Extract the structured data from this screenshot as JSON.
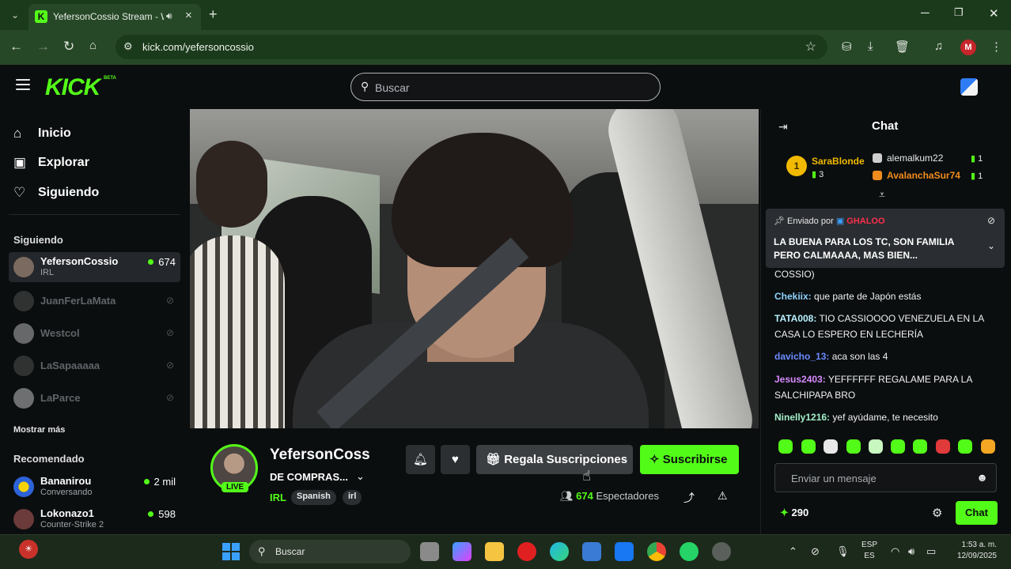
{
  "browser": {
    "tab_title": "YefersonCossio Stream - W",
    "new_tab": "+",
    "url": "kick.com/yefersoncossio",
    "profile_initial": "M",
    "win_minimize": "─",
    "win_maximize": "❐",
    "win_close": "✕"
  },
  "header": {
    "logo": "KICK",
    "logo_sup": "BETA",
    "search_placeholder": "Buscar"
  },
  "sidebar": {
    "nav": [
      {
        "label": "Inicio",
        "icon": "home-icon"
      },
      {
        "label": "Explorar",
        "icon": "compass-icon"
      },
      {
        "label": "Siguiendo",
        "icon": "heart-icon"
      }
    ],
    "following_heading": "Siguiendo",
    "following": [
      {
        "name": "YefersonCossio",
        "category": "IRL",
        "viewers": "674",
        "live": true
      },
      {
        "name": "JuanFerLaMata",
        "live": false
      },
      {
        "name": "Westcol",
        "live": false
      },
      {
        "name": "LaSapaaaaa",
        "live": false
      },
      {
        "name": "LaParce",
        "live": false
      }
    ],
    "show_more": "Mostrar más",
    "recommended_heading": "Recomendado",
    "recommended": [
      {
        "name": "Bananirou",
        "category": "Conversando",
        "viewers": "2 mil"
      },
      {
        "name": "Lokonazo1",
        "category": "Counter-Strike 2",
        "viewers": "598"
      }
    ]
  },
  "stream": {
    "name": "YefersonCoss",
    "live_badge": "LIVE",
    "title": "DE COMPRAS...",
    "category": "IRL",
    "tags": [
      "Spanish",
      "irl"
    ],
    "gift_button": "Regala Suscripciones",
    "subscribe_button": "Suscribirse",
    "viewers": "674",
    "viewers_label": "Espectadores"
  },
  "chat": {
    "title": "Chat",
    "top_gifter": {
      "rank": "1",
      "name": "SaraBlonde",
      "count": "3"
    },
    "top_others": [
      {
        "name": "alemalkum22",
        "count": "1",
        "color": "#e8e8e8"
      },
      {
        "name": "AvalanchaSur74",
        "count": "1",
        "color": "#f08c1e"
      }
    ],
    "pinned": {
      "sent_by": "Enviado por",
      "user": "GHALOO",
      "message": "LA BUENA PARA LOS TC, SON FAMILIA PERO CALMAAAA, MAS BIEN..."
    },
    "messages": [
      {
        "user": "",
        "text": "COSSIO)",
        "color": "#f0f0f0"
      },
      {
        "user": "Chekiix:",
        "text": "que parte de Japón estás",
        "color": "#8fd3ff"
      },
      {
        "user": "TATA008:",
        "text": "TIO CASSIOOOO VENEZUELA EN LA CASA LO ESPERO EN LECHERÍA",
        "color": "#b6f0ff"
      },
      {
        "user": "davicho_13:",
        "text": "aca son las 4",
        "color": "#6b8cff"
      },
      {
        "user": "Jesus2403:",
        "text": "YEFFFFFF REGALAME PARA LA SALCHIPAPA BRO",
        "color": "#d88bff"
      },
      {
        "user": "Ninelly1216:",
        "text": "yef ayúdame, te necesito",
        "color": "#a5f0c9"
      }
    ],
    "input_placeholder": "Enviar un mensaje",
    "points": "290",
    "send_button": "Chat"
  },
  "taskbar": {
    "search": "Buscar",
    "lang_top": "ESP",
    "lang_bottom": "ES",
    "time": "1:53 a. m.",
    "date": "12/09/2025"
  },
  "colors": {
    "accent": "#53fc18",
    "background": "#0b0e0f"
  }
}
